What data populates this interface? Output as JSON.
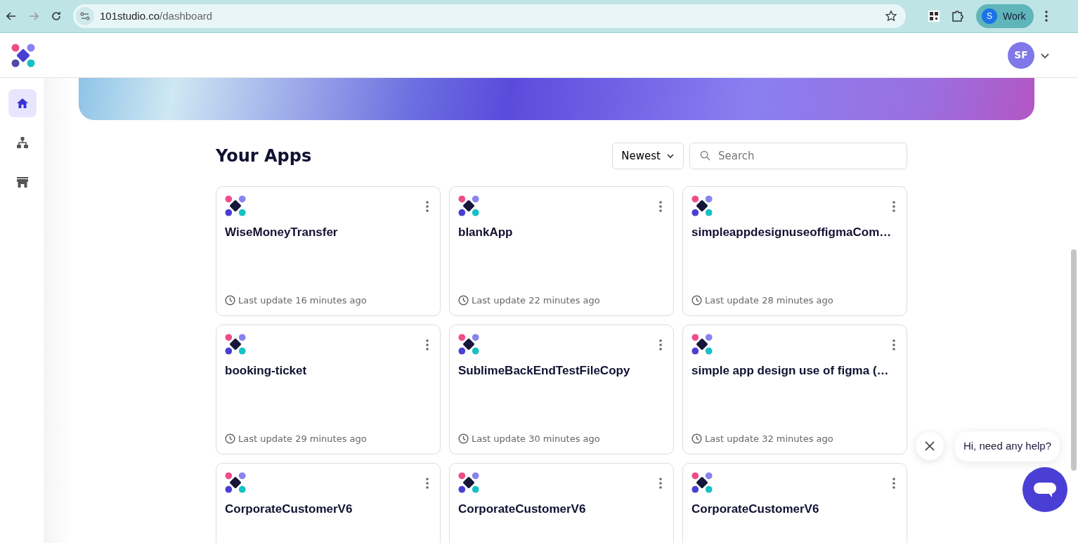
{
  "browser": {
    "url_host": "101studio.co",
    "url_path": "/dashboard",
    "profile_initial": "S",
    "profile_label": "Work"
  },
  "header": {
    "avatar_initials": "SF"
  },
  "sidebar": {
    "items": [
      {
        "kind": "home",
        "selected": true
      },
      {
        "kind": "hierarchy",
        "selected": false
      },
      {
        "kind": "store",
        "selected": false
      }
    ]
  },
  "apps": {
    "title": "Your Apps",
    "sort": "Newest",
    "search": {
      "placeholder": "Search"
    },
    "cards": [
      {
        "name": "WiseMoneyTransfer",
        "updated": "Last update 16 minutes ago"
      },
      {
        "name": "blankApp",
        "updated": "Last update 22 minutes ago"
      },
      {
        "name": "simpleappdesignuseoffigmaCom…",
        "updated": "Last update 28 minutes ago"
      },
      {
        "name": "booking-ticket",
        "updated": "Last update 29 minutes ago"
      },
      {
        "name": "SublimeBackEndTestFileCopy",
        "updated": "Last update 30 minutes ago"
      },
      {
        "name": "simple app design use of figma (…",
        "updated": "Last update 32 minutes ago"
      },
      {
        "name": "CorporateCustomerV6"
      },
      {
        "name": "CorporateCustomerV6"
      },
      {
        "name": "CorporateCustomerV6"
      }
    ]
  },
  "chat": {
    "greeting": "Hi, need any help?"
  }
}
